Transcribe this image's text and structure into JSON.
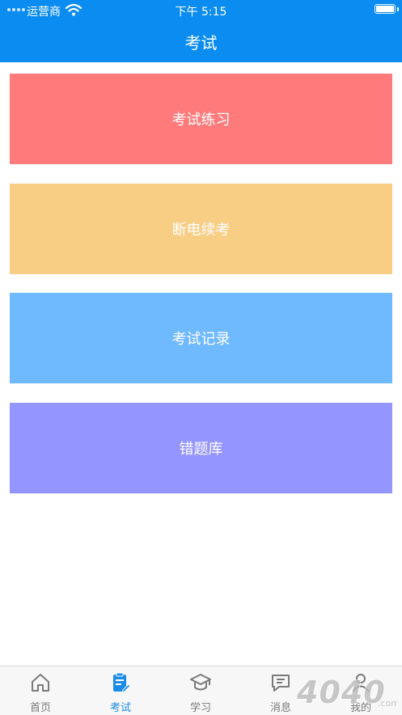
{
  "status": {
    "carrier": "运营商",
    "time": "下午 5:15"
  },
  "header": {
    "title": "考试"
  },
  "cards": [
    {
      "label": "考试练习",
      "color": "#ff7b7b"
    },
    {
      "label": "断电续考",
      "color": "#f8ce85"
    },
    {
      "label": "考试记录",
      "color": "#6fb9ff"
    },
    {
      "label": "错题库",
      "color": "#9595ff"
    }
  ],
  "tabs": [
    {
      "label": "首页",
      "icon": "home-icon"
    },
    {
      "label": "考试",
      "icon": "exam-icon"
    },
    {
      "label": "学习",
      "icon": "graduation-cap-icon"
    },
    {
      "label": "消息",
      "icon": "message-icon"
    },
    {
      "label": "我的",
      "icon": "user-icon"
    }
  ],
  "active_tab": "考试",
  "colors": {
    "primary": "#0a8cf0",
    "tab_active": "#1b8be8",
    "tab_inactive": "#7a7a7a"
  },
  "watermark": {
    "text": "4040"
  }
}
